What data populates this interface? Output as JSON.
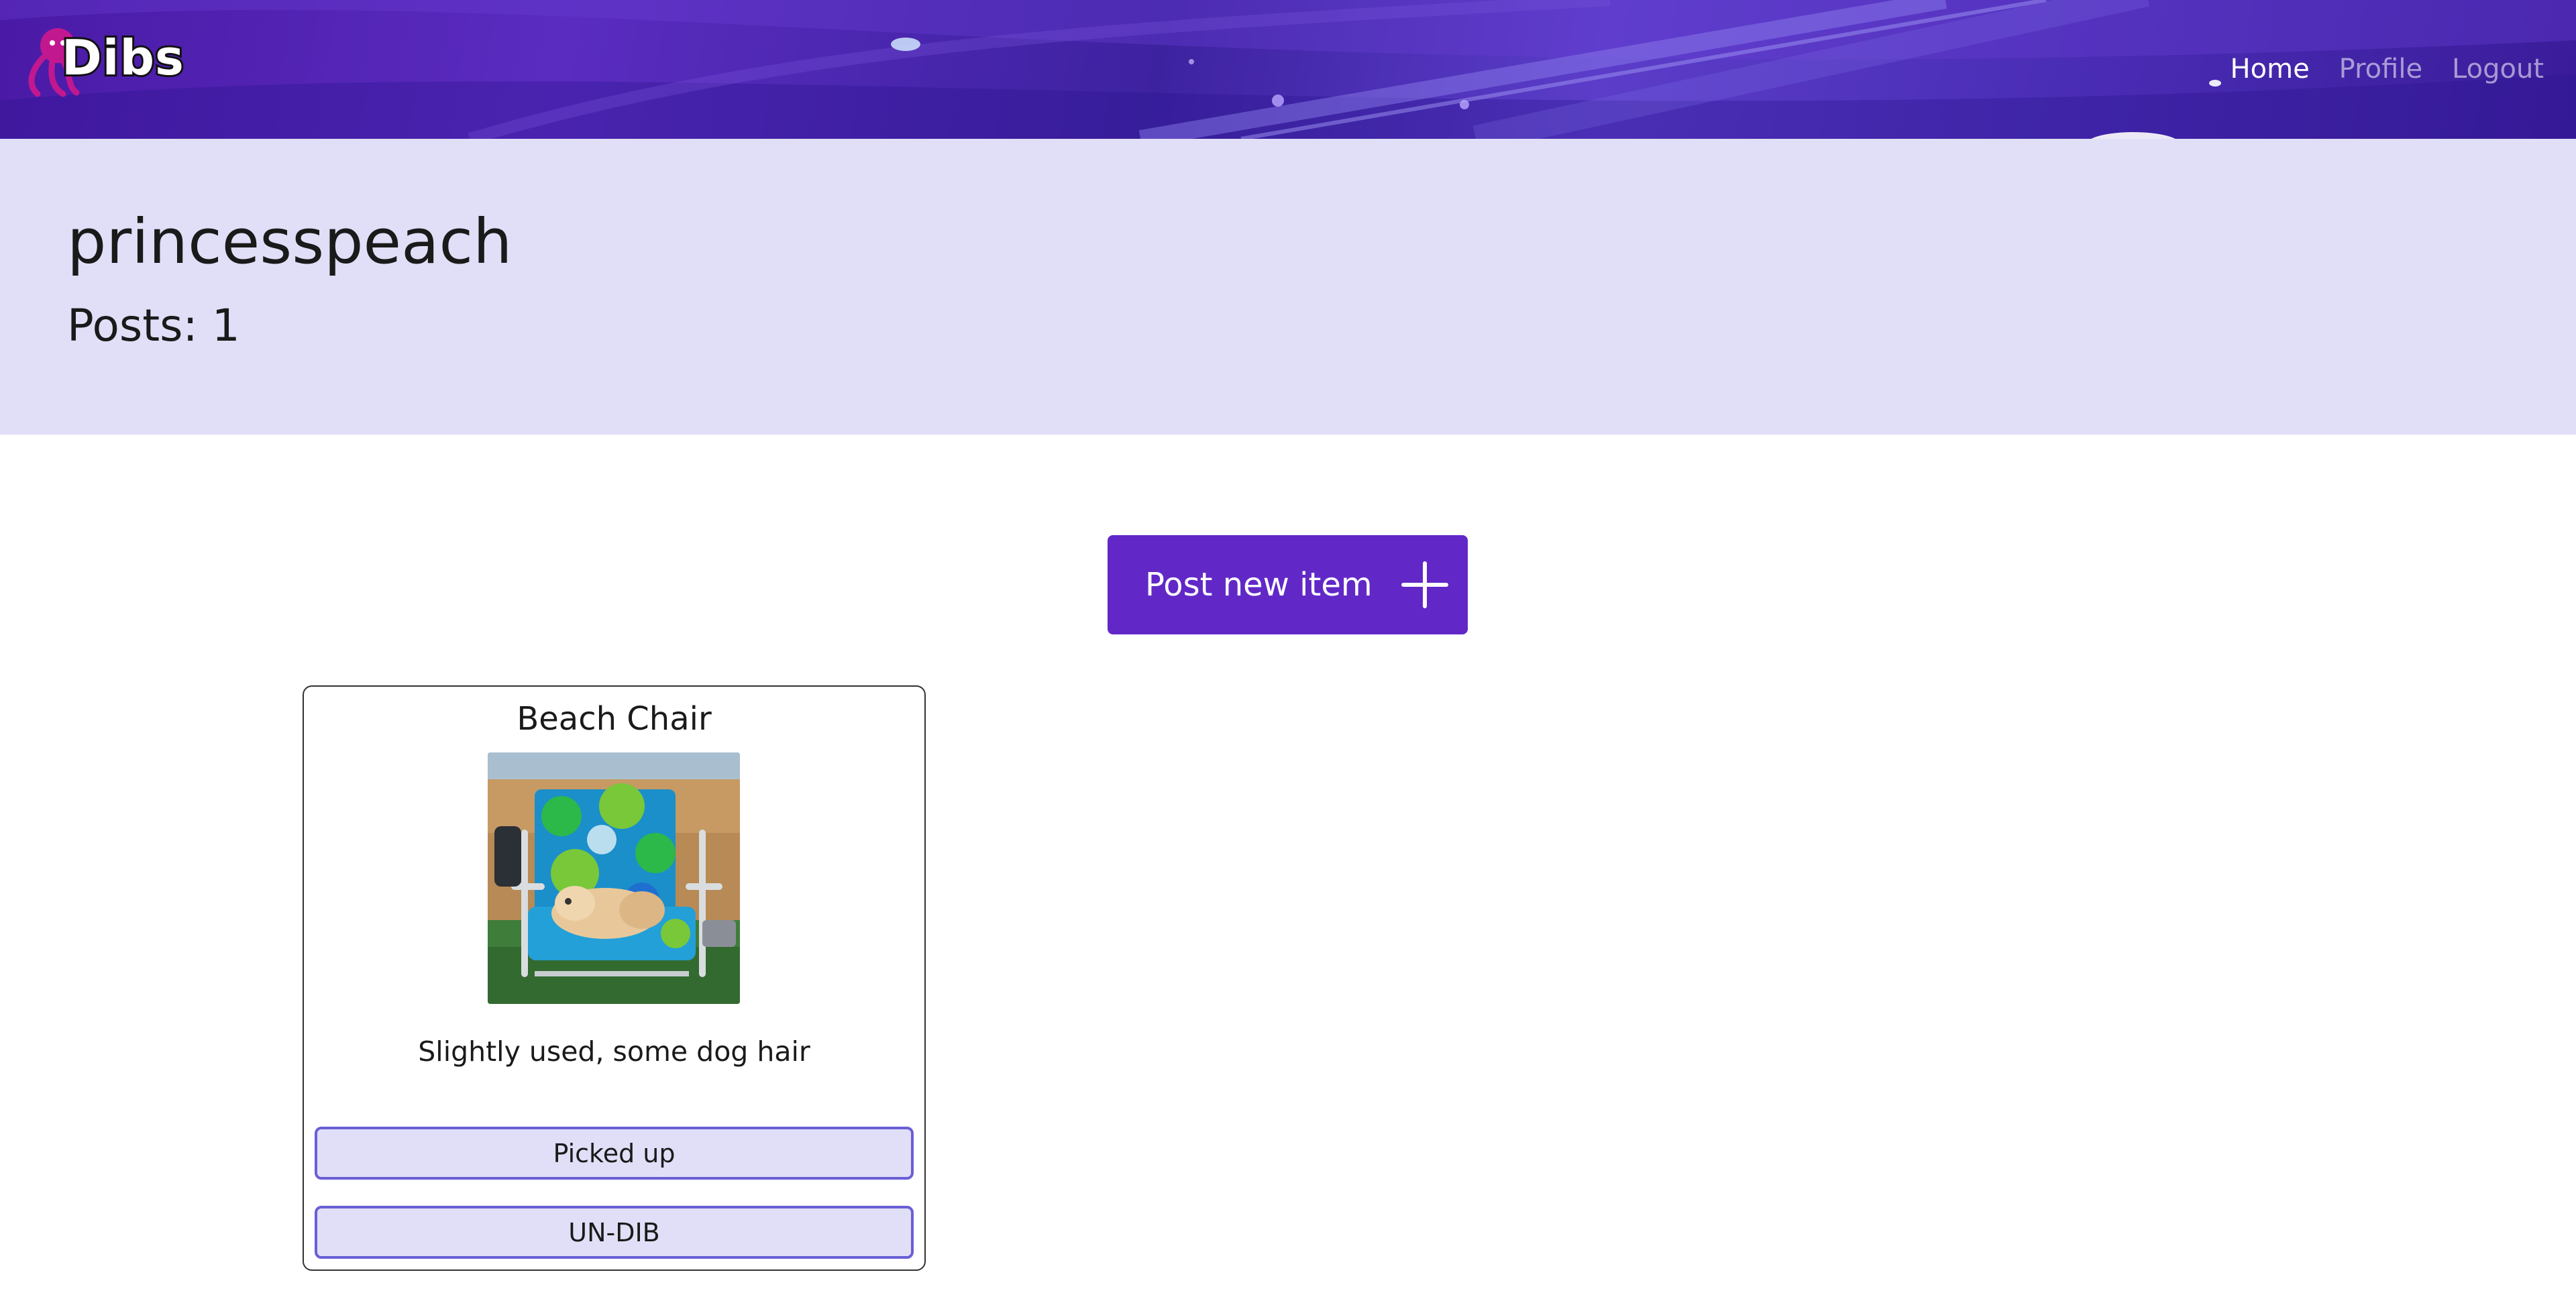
{
  "navbar": {
    "brand": "Dibs",
    "links": [
      {
        "label": "Home",
        "active": true
      },
      {
        "label": "Profile",
        "active": false
      },
      {
        "label": "Logout",
        "active": false
      }
    ],
    "brand_accent": "#c2188f",
    "background": "#4a1aa6"
  },
  "profile": {
    "username": "princesspeach",
    "posts_label": "Posts: ",
    "posts_count": "1",
    "header_background": "#e0dff7"
  },
  "actions": {
    "post_new_item_label": "Post new item",
    "post_new_item_icon": "plus-icon",
    "button_color": "#6128c7"
  },
  "items": [
    {
      "title": "Beach Chair",
      "image": "beach-chair-photo",
      "description": "Slightly used, some dog hair",
      "buttons": [
        "Picked up",
        "UN-DIB"
      ]
    }
  ]
}
